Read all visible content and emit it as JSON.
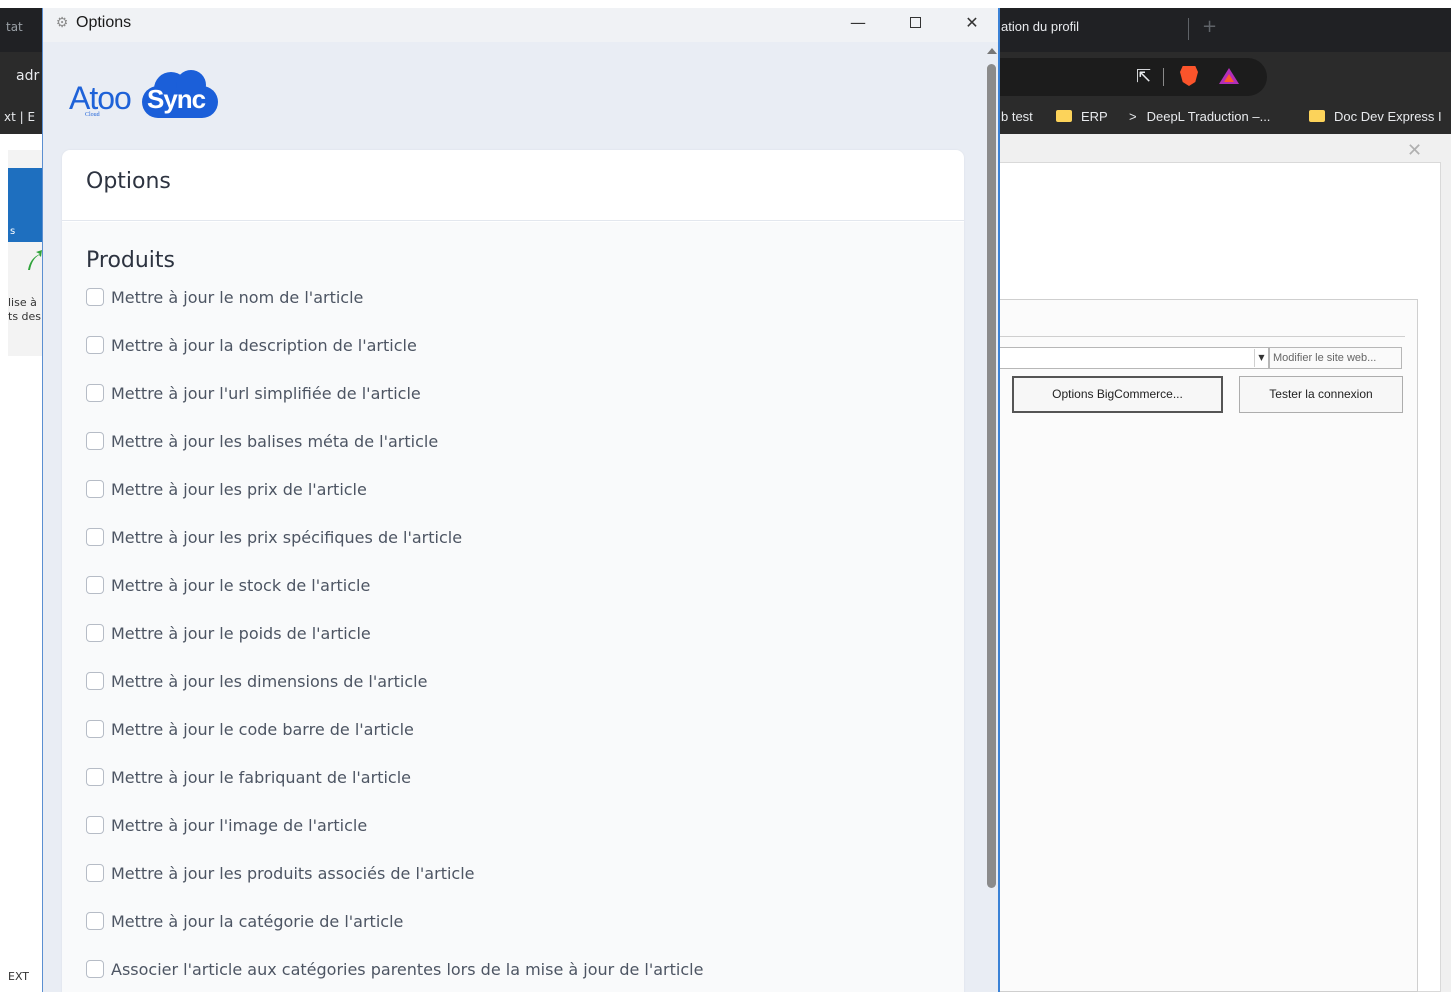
{
  "window": {
    "title": "Options",
    "minimize_label": "—",
    "close_label": "✕"
  },
  "logo": {
    "atoo": "Atoo",
    "sync": "Sync",
    "cloud": "Cloud"
  },
  "card": {
    "title": "Options"
  },
  "section": {
    "title": "Produits"
  },
  "options": [
    {
      "label": "Mettre à jour le nom de l'article",
      "checked": false
    },
    {
      "label": "Mettre à jour la description de l'article",
      "checked": false
    },
    {
      "label": "Mettre à jour l'url simplifiée de l'article",
      "checked": false
    },
    {
      "label": "Mettre à jour les balises méta de l'article",
      "checked": false
    },
    {
      "label": "Mettre à jour les prix de l'article",
      "checked": false
    },
    {
      "label": "Mettre à jour les prix spécifiques de l'article",
      "checked": false
    },
    {
      "label": "Mettre à jour le stock de l'article",
      "checked": false
    },
    {
      "label": "Mettre à jour le poids de l'article",
      "checked": false
    },
    {
      "label": "Mettre à jour les dimensions de l'article",
      "checked": false
    },
    {
      "label": "Mettre à jour le code barre de l'article",
      "checked": false
    },
    {
      "label": "Mettre à jour le fabriquant de l'article",
      "checked": false
    },
    {
      "label": "Mettre à jour l'image de l'article",
      "checked": false
    },
    {
      "label": "Mettre à jour les produits associés de l'article",
      "checked": false
    },
    {
      "label": "Mettre à jour la catégorie de l'article",
      "checked": false
    },
    {
      "label": "Associer l'article aux catégories parentes lors de la mise à jour de l'article",
      "checked": false
    }
  ],
  "background_left": {
    "tab_text": "tat",
    "address_text": "adr",
    "bookmark_text": "xt | E",
    "panel_text": "s",
    "label_line1": "lise à",
    "label_line2": "ts des",
    "ext_text": "EXT"
  },
  "background_browser": {
    "tab_title": "ation du profil",
    "new_tab": "+",
    "bookmarks": [
      {
        "label": "b test",
        "kind": "text"
      },
      {
        "label": "ERP",
        "kind": "folder"
      },
      {
        "label": "DeepL Traduction –...",
        "kind": "link"
      },
      {
        "label": "Doc Dev Express I",
        "kind": "folder"
      }
    ],
    "dialog_close": "✕",
    "modify_site_button": "Modifier le site web...",
    "options_bigcommerce_button": "Options BigCommerce...",
    "test_connection_button": "Tester la connexion"
  },
  "colors": {
    "brand_blue": "#1b5fd9",
    "window_border": "#3b82d6",
    "card_text": "#2d3340",
    "option_text": "#4d5563"
  }
}
